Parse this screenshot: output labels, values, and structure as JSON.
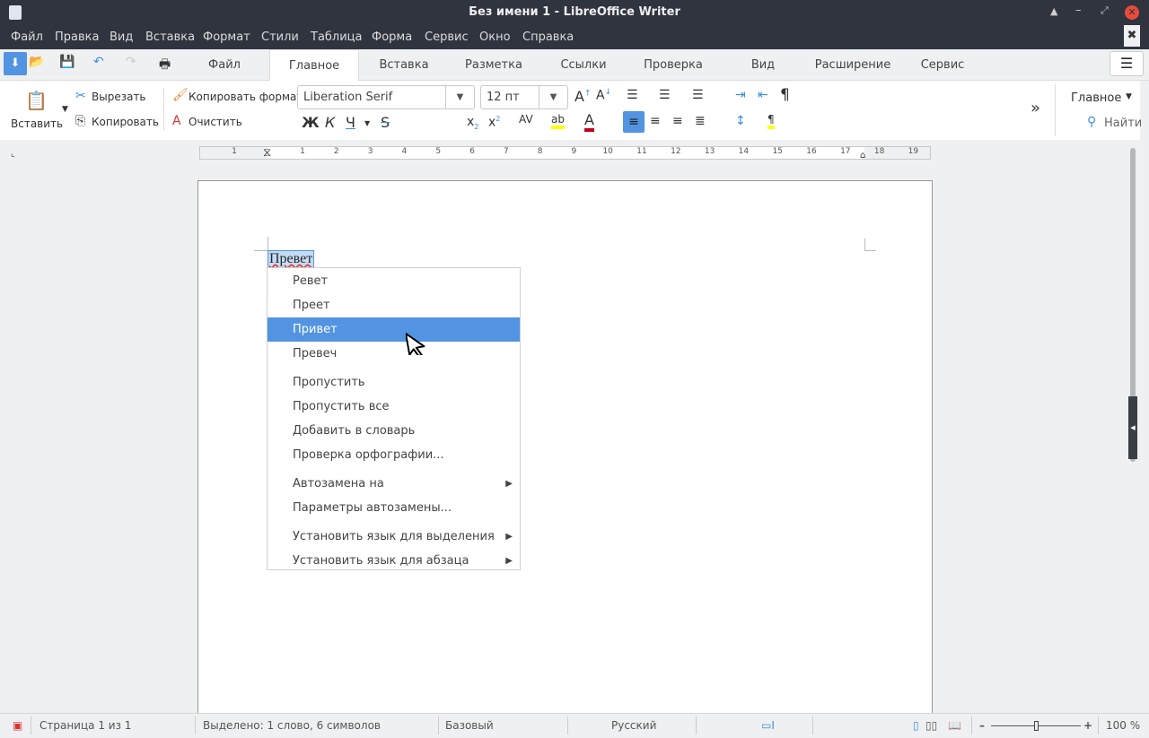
{
  "window": {
    "title": "Без имени 1 - LibreOffice Writer"
  },
  "menubar": [
    "Файл",
    "Правка",
    "Вид",
    "Вставка",
    "Формат",
    "Стили",
    "Таблица",
    "Форма",
    "Сервис",
    "Окно",
    "Справка"
  ],
  "tabs": [
    {
      "label": "Файл"
    },
    {
      "label": "Главное",
      "active": true
    },
    {
      "label": "Вставка"
    },
    {
      "label": "Разметка"
    },
    {
      "label": "Ссылки"
    },
    {
      "label": "Проверка"
    },
    {
      "label": "Вид"
    },
    {
      "label": "Расширение"
    },
    {
      "label": "Сервис"
    }
  ],
  "ribbon": {
    "paste": "Вставить",
    "cut": "Вырезать",
    "copy": "Копировать",
    "clone": "Копировать формат",
    "clear": "Очистить",
    "font": "Liberation Serif",
    "size": "12 пт",
    "bold": "Ж",
    "italic": "К",
    "underline": "Ч",
    "strike": "S",
    "more": "»",
    "style_menu": "Главное",
    "find": "Найти"
  },
  "ruler": {
    "left_label": "1",
    "labels": [
      "1",
      "2",
      "3",
      "4",
      "5",
      "6",
      "7",
      "8",
      "9",
      "10",
      "11",
      "12",
      "13",
      "14",
      "15",
      "16",
      "17",
      "18",
      "19"
    ]
  },
  "document": {
    "text": "Превет"
  },
  "context_menu": {
    "items": [
      {
        "label": "Ревет"
      },
      {
        "label": "Прeет"
      },
      {
        "label": "Привет",
        "selected": true
      },
      {
        "label": "Превеч"
      },
      {
        "label": "Пропустить"
      },
      {
        "label": "Пропустить все"
      },
      {
        "label": "Добавить в словарь"
      },
      {
        "label": "Проверка орфографии..."
      },
      {
        "label": "Автозамена на",
        "submenu": true
      },
      {
        "label": "Параметры автозамены..."
      },
      {
        "label": "Установить язык для выделения",
        "submenu": true
      },
      {
        "label": "Установить язык для абзаца",
        "submenu": true
      }
    ]
  },
  "status": {
    "page": "Страница 1 из 1",
    "selection": "Выделено: 1 слово, 6 символов",
    "style": "Базовый",
    "language": "Русский",
    "zoom": "100 %",
    "zoom_level_percent": 100
  },
  "colors": {
    "accent": "#5294e2",
    "titlebar": "#2f343f",
    "close": "#e74c3c",
    "highlight": "#ffff00",
    "font_color": "#c0001a"
  }
}
